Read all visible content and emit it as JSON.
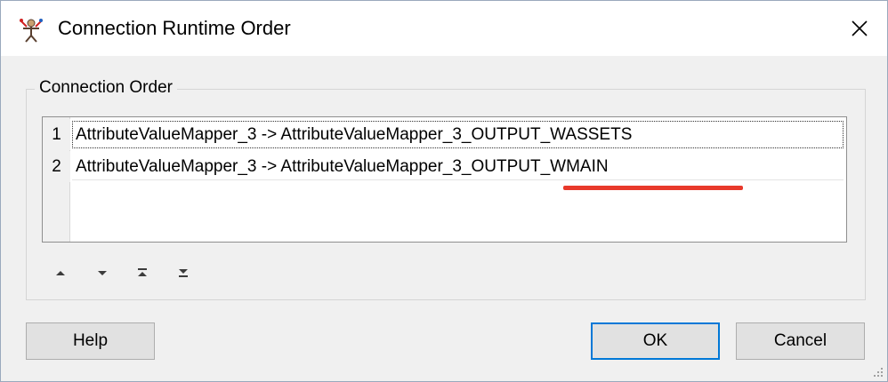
{
  "window": {
    "title": "Connection Runtime Order",
    "icon": "fme-workbench-icon",
    "close_icon": "close-icon"
  },
  "group": {
    "label": "Connection Order"
  },
  "connections": [
    {
      "index": "1",
      "text": "AttributeValueMapper_3 -> AttributeValueMapper_3_OUTPUT_WASSETS"
    },
    {
      "index": "2",
      "text": "AttributeValueMapper_3 -> AttributeValueMapper_3_OUTPUT_WMAIN"
    }
  ],
  "order_controls": [
    {
      "name": "move-up-icon"
    },
    {
      "name": "move-down-icon"
    },
    {
      "name": "move-to-top-icon"
    },
    {
      "name": "move-to-bottom-icon"
    }
  ],
  "buttons": {
    "help": "Help",
    "ok": "OK",
    "cancel": "Cancel"
  },
  "colors": {
    "accent": "#0078d7",
    "annotation": "#e8392b"
  }
}
